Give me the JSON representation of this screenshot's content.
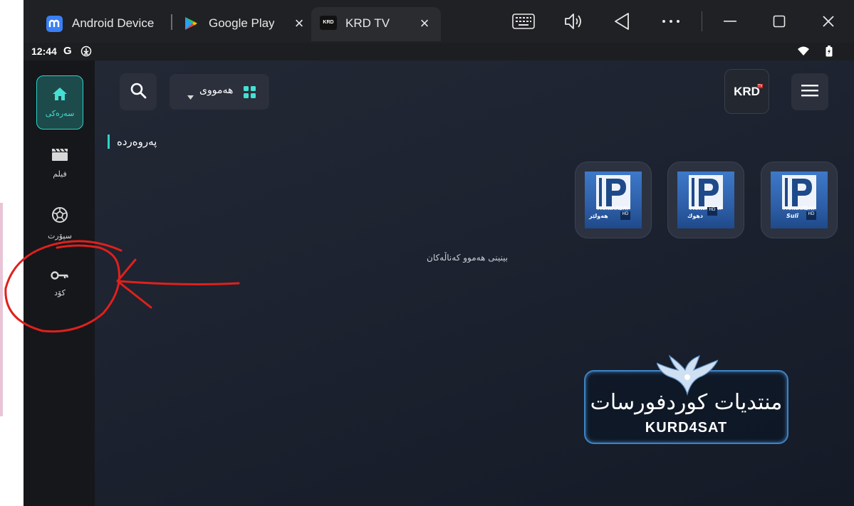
{
  "window": {
    "tabs": [
      {
        "label": "Android Device",
        "icon": "app-logo-icon",
        "active": false
      },
      {
        "label": "Google Play",
        "icon": "google-play-icon",
        "active": false
      },
      {
        "label": "KRD TV",
        "icon": "krd-logo-icon",
        "active": true
      }
    ],
    "controls": [
      "keyboard-icon",
      "volume-icon",
      "back-icon",
      "more-icon",
      "minimize-icon",
      "maximize-icon",
      "close-icon"
    ]
  },
  "statusbar": {
    "time": "12:44",
    "g_label": "G"
  },
  "rail": {
    "items": [
      {
        "label": "سەرەکی",
        "icon": "home-icon",
        "active": true
      },
      {
        "label": "فیلم",
        "icon": "movie-icon",
        "active": false
      },
      {
        "label": "سپۆرت",
        "icon": "football-icon",
        "active": false
      },
      {
        "label": "کۆد",
        "icon": "key-icon",
        "active": false
      }
    ]
  },
  "header": {
    "filter_label": "هەمووی",
    "logo_text": "KRD",
    "logo_badge": "TV"
  },
  "section": {
    "title": "پەروەردە",
    "view_all": "بینینی هەموو کەناڵەکان"
  },
  "channels": [
    {
      "name": "PARWARDAY",
      "sub": "Sulî",
      "hd": "HD"
    },
    {
      "name": "PARWARDAY",
      "sub": "دهوك",
      "hd": "HD"
    },
    {
      "name": "PARWARDAY",
      "sub": "هەولێر",
      "hd": "HD"
    }
  ],
  "watermark": {
    "arabic": "منتديات كوردفورسات",
    "english": "KURD4SAT"
  },
  "colors": {
    "accent": "#2bd4c8",
    "annotation": "#e0201c",
    "rail_bg": "#15171b"
  }
}
